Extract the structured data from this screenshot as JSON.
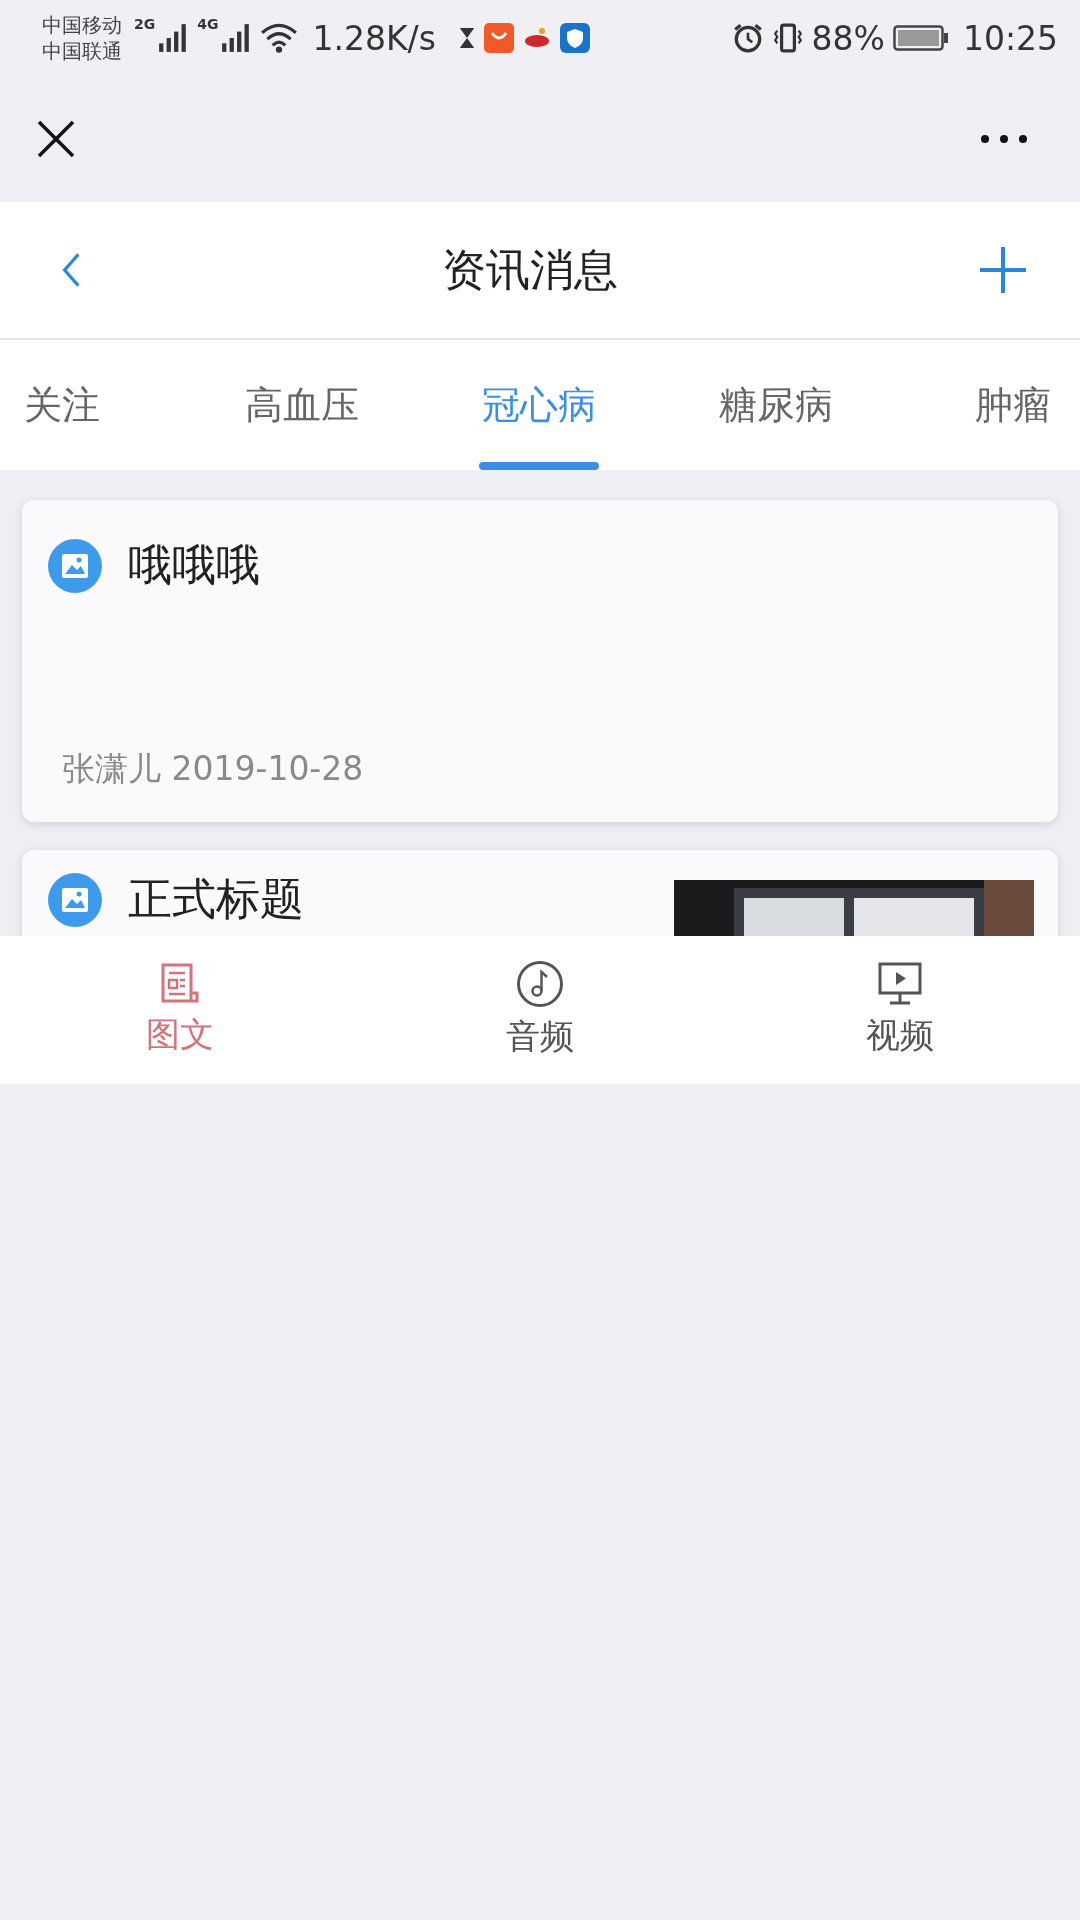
{
  "status_bar": {
    "carriers": [
      "中国移动",
      "中国联通"
    ],
    "networks": [
      "2G",
      "4G"
    ],
    "speed": "1.28K/s",
    "battery": "88%",
    "time": "10:25"
  },
  "header": {
    "title": "资讯消息"
  },
  "tabs": [
    {
      "label": "关注",
      "selected": false
    },
    {
      "label": "高血压",
      "selected": false
    },
    {
      "label": "冠心病",
      "selected": true
    },
    {
      "label": "糖尿病",
      "selected": false
    },
    {
      "label": "肿瘤",
      "selected": false
    }
  ],
  "articles": [
    {
      "kind": "text",
      "title": "哦哦哦",
      "meta": "张潇儿 2019-10-28"
    },
    {
      "kind": "picture",
      "title": "正式标题"
    }
  ],
  "bottom_nav": [
    {
      "label": "图文",
      "kind": "article",
      "selected": true
    },
    {
      "label": "音频",
      "kind": "audio",
      "selected": false
    },
    {
      "label": "视频",
      "kind": "video",
      "selected": false
    }
  ]
}
